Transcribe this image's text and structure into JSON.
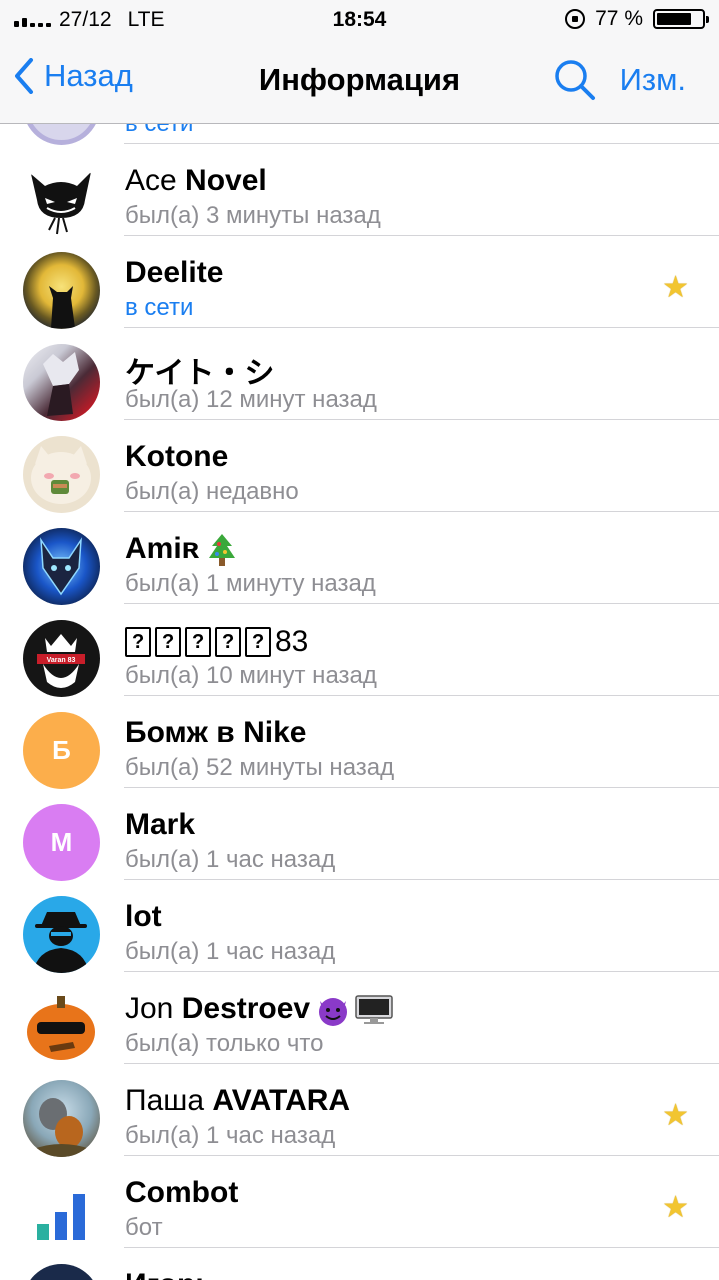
{
  "status_bar": {
    "carrier": "27/12",
    "network": "LTE",
    "time": "18:54",
    "battery_percent": "77 %",
    "battery_level": 0.77
  },
  "nav": {
    "back_label": "Назад",
    "title": "Информация",
    "edit_label": "Изм."
  },
  "partial_top": {
    "status": "в сети"
  },
  "contacts": [
    {
      "first": "Ace",
      "last": "Novel",
      "status": "был(а) 3 минуты назад",
      "online": false,
      "starred": false,
      "avatar": "devil-cat"
    },
    {
      "first": "",
      "last": "Deelite",
      "status": "в сети",
      "online": true,
      "starred": true,
      "avatar": "moon-cat"
    },
    {
      "first": "",
      "last": "ケイト・シ",
      "status": "был(а) 12 минут назад",
      "online": false,
      "starred": false,
      "avatar": "anime"
    },
    {
      "first": "",
      "last": "Kotone",
      "status": "был(а) недавно",
      "online": false,
      "starred": false,
      "avatar": "cat"
    },
    {
      "first": "",
      "last": "Amiʀ",
      "status": "был(а) 1 минуту назад",
      "online": false,
      "starred": false,
      "avatar": "wolf"
    },
    {
      "first": "",
      "last": "83",
      "status": "был(а) 10 минут назад",
      "online": false,
      "starred": false,
      "avatar": "king",
      "avatar_text": "Varan 83"
    },
    {
      "first": "",
      "last": "Бомж в Nike",
      "status": "был(а) 52 минуты назад",
      "online": false,
      "starred": false,
      "avatar": "letter",
      "initial": "Б",
      "color": "#fcae4b"
    },
    {
      "first": "",
      "last": "Mark",
      "status": "был(а) 1 час назад",
      "online": false,
      "starred": false,
      "avatar": "letter",
      "initial": "M",
      "color": "#d97df2"
    },
    {
      "first": "",
      "last": "lot",
      "status": "был(а) 1 час назад",
      "online": false,
      "starred": false,
      "avatar": "spy"
    },
    {
      "first": "Jon",
      "last": "Destroev",
      "status": "был(а) только что",
      "online": false,
      "starred": false,
      "avatar": "pumpkin"
    },
    {
      "first": "Паша",
      "last": "AVATARA",
      "status": "был(а) 1 час назад",
      "online": false,
      "starred": true,
      "avatar": "mouse"
    },
    {
      "first": "",
      "last": "Combot",
      "status": "бот",
      "online": false,
      "starred": true,
      "avatar": "combot"
    },
    {
      "first": "",
      "last": "Игорь",
      "status": "",
      "online": false,
      "starred": false,
      "avatar": "dark"
    }
  ],
  "icons": {
    "back": "chevron-left-icon",
    "search": "search-icon",
    "star": "star-icon"
  },
  "colors": {
    "accent": "#1a7ef0",
    "star": "#f2c530",
    "secondary_text": "#8e8e93"
  }
}
